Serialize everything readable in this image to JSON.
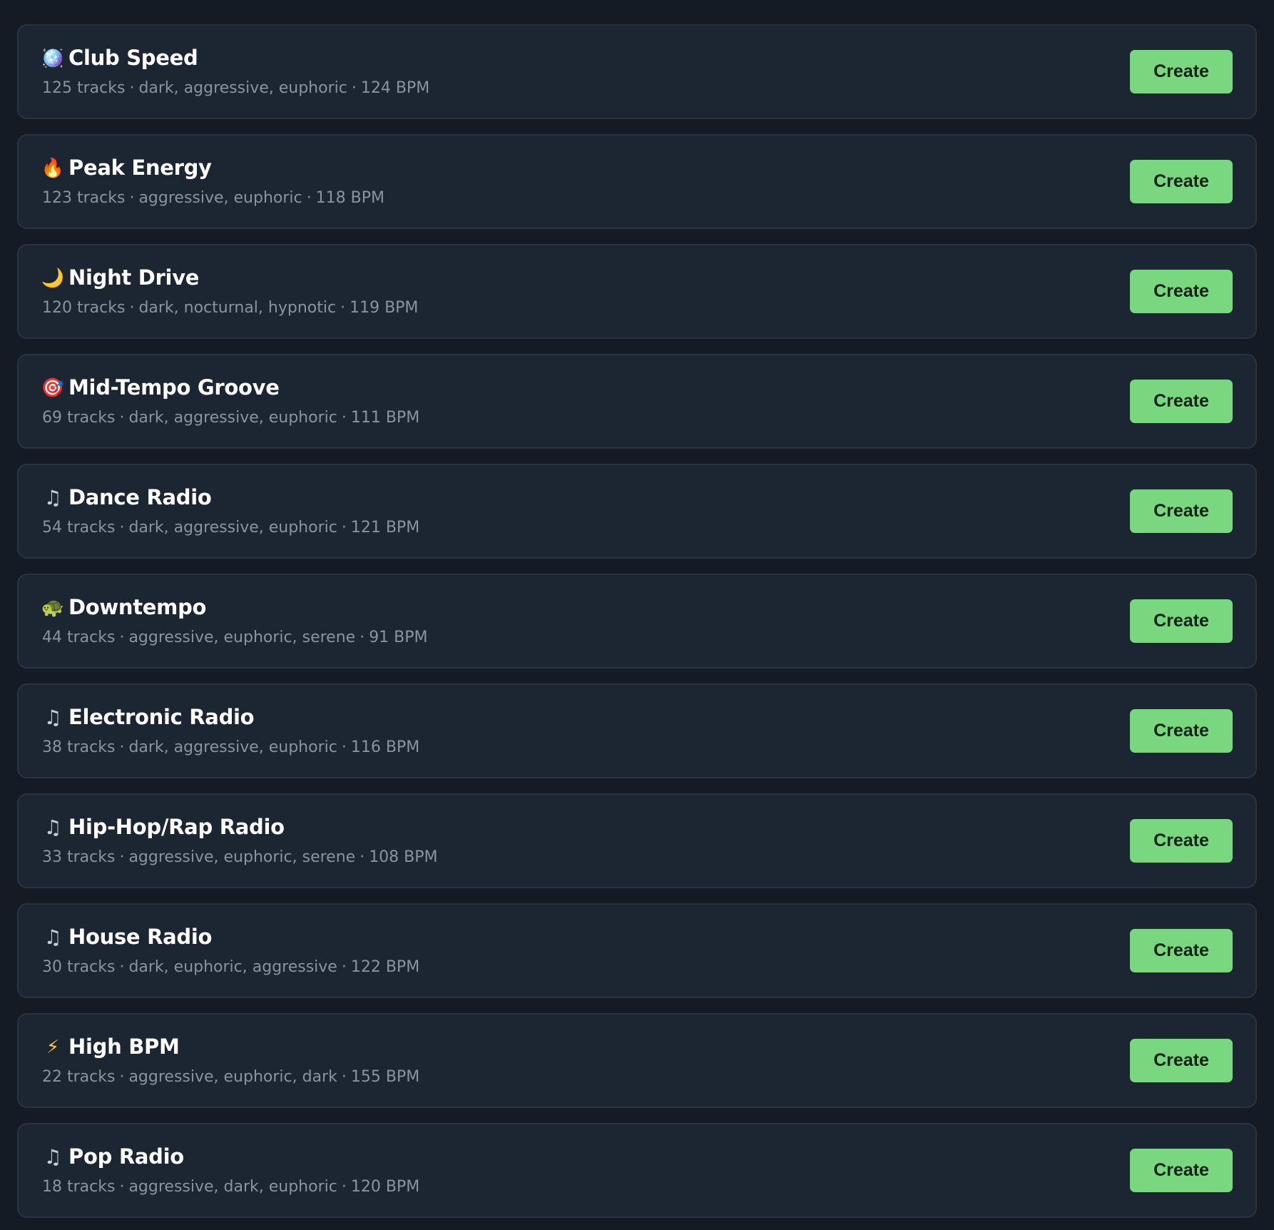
{
  "colors": {
    "background": "#141b25",
    "card": "#1c2532",
    "card_border": "#2a3441",
    "title": "#ffffff",
    "meta": "#8a93a1",
    "button": "#79d780",
    "button_text": "#122016"
  },
  "presets": [
    {
      "icon": "disco-ball-icon",
      "glyph": "🪩",
      "title": "Club Speed",
      "tracks": "125 tracks",
      "moods": "dark, aggressive, euphoric",
      "bpm": "124 BPM",
      "button": "Create"
    },
    {
      "icon": "fire-icon",
      "glyph": "🔥",
      "title": "Peak Energy",
      "tracks": "123 tracks",
      "moods": "aggressive, euphoric",
      "bpm": "118 BPM",
      "button": "Create"
    },
    {
      "icon": "moon-icon",
      "glyph": "🌙",
      "title": "Night Drive",
      "tracks": "120 tracks",
      "moods": "dark, nocturnal, hypnotic",
      "bpm": "119 BPM",
      "button": "Create"
    },
    {
      "icon": "target-icon",
      "glyph": "🎯",
      "title": "Mid-Tempo Groove",
      "tracks": "69 tracks",
      "moods": "dark, aggressive, euphoric",
      "bpm": "111 BPM",
      "button": "Create"
    },
    {
      "icon": "music-note-icon",
      "glyph": "♫",
      "title": "Dance Radio",
      "tracks": "54 tracks",
      "moods": "dark, aggressive, euphoric",
      "bpm": "121 BPM",
      "button": "Create"
    },
    {
      "icon": "turtle-icon",
      "glyph": "🐢",
      "title": "Downtempo",
      "tracks": "44 tracks",
      "moods": "aggressive, euphoric, serene",
      "bpm": "91 BPM",
      "button": "Create"
    },
    {
      "icon": "music-note-icon",
      "glyph": "♫",
      "title": "Electronic Radio",
      "tracks": "38 tracks",
      "moods": "dark, aggressive, euphoric",
      "bpm": "116 BPM",
      "button": "Create"
    },
    {
      "icon": "music-note-icon",
      "glyph": "♫",
      "title": "Hip-Hop/Rap Radio",
      "tracks": "33 tracks",
      "moods": "aggressive, euphoric, serene",
      "bpm": "108 BPM",
      "button": "Create"
    },
    {
      "icon": "music-note-icon",
      "glyph": "♫",
      "title": "House Radio",
      "tracks": "30 tracks",
      "moods": "dark, euphoric, aggressive",
      "bpm": "122 BPM",
      "button": "Create"
    },
    {
      "icon": "lightning-icon",
      "glyph": "⚡",
      "title": "High BPM",
      "tracks": "22 tracks",
      "moods": "aggressive, euphoric, dark",
      "bpm": "155 BPM",
      "button": "Create"
    },
    {
      "icon": "music-note-icon",
      "glyph": "♫",
      "title": "Pop Radio",
      "tracks": "18 tracks",
      "moods": "aggressive, dark, euphoric",
      "bpm": "120 BPM",
      "button": "Create"
    }
  ]
}
